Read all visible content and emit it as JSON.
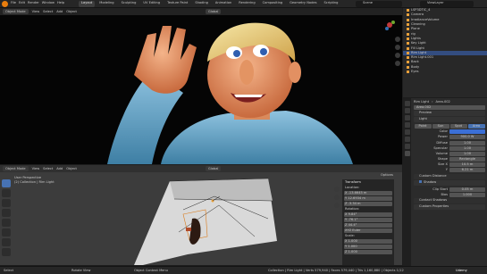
{
  "menu": {
    "items": [
      "File",
      "Edit",
      "Render",
      "Window",
      "Help"
    ]
  },
  "workspace_tabs": [
    "Layout",
    "Modeling",
    "Sculpting",
    "UV Editing",
    "Texture Paint",
    "Shading",
    "Animation",
    "Rendering",
    "Compositing",
    "Geometry Nodes",
    "Scripting"
  ],
  "scene": "Scene",
  "view_layer": "ViewLayer",
  "viewport_top": {
    "mode": "Object Mode",
    "menus": [
      "View",
      "Select",
      "Add",
      "Object"
    ],
    "transform": "Global"
  },
  "viewport_bottom": {
    "mode": "Object Mode",
    "menus": [
      "View",
      "Select",
      "Add",
      "Object"
    ],
    "transform": "Global",
    "info_line1": "User Perspective",
    "info_line2": "(2) Collection | Rim Light",
    "options": "Options"
  },
  "npanel": {
    "title": "Transform",
    "location_label": "Location:",
    "location": [
      "X  -13.6645 m",
      "Y  12.6934 m",
      "Z  -3.34 m"
    ],
    "rotation_label": "Rotation:",
    "rotation": [
      "X  9.84°",
      "Y  -76.1°",
      "Z  44.4°"
    ],
    "mode": "XYZ Euler",
    "scale_label": "Scale:",
    "scale": [
      "X  1.000",
      "Y  1.000",
      "Z  1.000"
    ]
  },
  "outliner": {
    "rows": [
      {
        "name": "LSP3DTIC_4",
        "sel": false
      },
      {
        "name": "Camera",
        "sel": false
      },
      {
        "name": "IrradianceVolume",
        "sel": false
      },
      {
        "name": "Cleaning",
        "sel": false
      },
      {
        "name": "Plane",
        "sel": false
      },
      {
        "name": "rig",
        "sel": false
      },
      {
        "name": "Lights",
        "sel": false
      },
      {
        "name": "Key Light",
        "sel": false
      },
      {
        "name": "Fill Light",
        "sel": false
      },
      {
        "name": "Rim Light",
        "sel": true
      },
      {
        "name": "Rim Light.001",
        "sel": false
      },
      {
        "name": "Back",
        "sel": false
      },
      {
        "name": "Body",
        "sel": false
      },
      {
        "name": "Eyes",
        "sel": false
      }
    ]
  },
  "properties": {
    "object": "Rim Light",
    "data": "Area.002",
    "datablock": "Area.002",
    "preview": "Preview",
    "light": "Light",
    "light_types": [
      "Point",
      "Sun",
      "Spot",
      "Area"
    ],
    "rows": [
      {
        "label": "Color",
        "value": ""
      },
      {
        "label": "Power",
        "value": "900.0 W"
      },
      {
        "label": "Diffuse",
        "value": "1.00"
      },
      {
        "label": "Specular",
        "value": "1.00"
      },
      {
        "label": "Volume",
        "value": "1.00"
      },
      {
        "label": "Shape",
        "value": "Rectangle"
      },
      {
        "label": "Size X",
        "value": "10.5 m"
      },
      {
        "label": "Y",
        "value": "6.21 m"
      }
    ],
    "custom_distance": "Custom Distance",
    "shadow": "Shadow",
    "shadow_rows": [
      {
        "label": "Clip Start",
        "value": "0.05 m"
      },
      {
        "label": "Bias",
        "value": "1.000"
      }
    ],
    "contact_shadows": "Contact Shadows",
    "custom_props": "Custom Properties"
  },
  "status": {
    "left": "Select",
    "mid": "Rotate View",
    "right": "Object Context Menu",
    "stats": "Collection | Rim Light | Verts 579,940 | Faces 579,440 | Tris 1,160,880 | Objects 1/12",
    "udemy": "Udemy"
  },
  "colors": {
    "accent": "#4772b3",
    "light_color": "#3b6fd6",
    "select": "#334d80"
  }
}
